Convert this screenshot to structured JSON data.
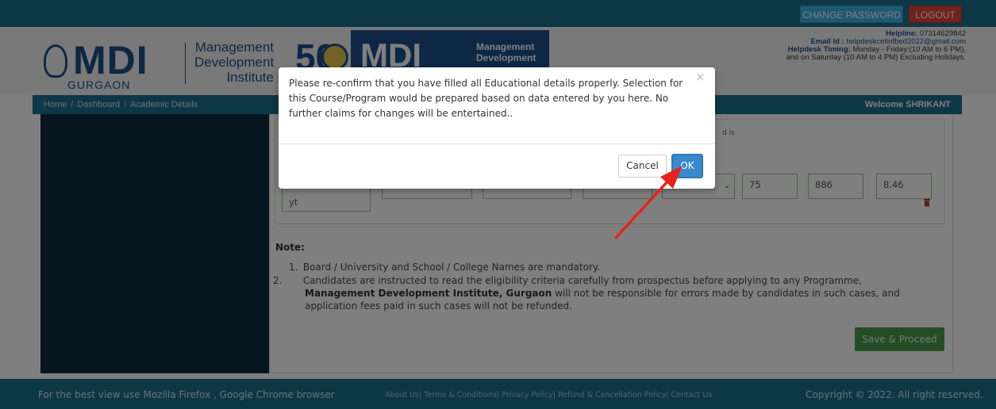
{
  "topbar": {
    "change_password": "CHANGE PASSWORD",
    "logout": "LOGOUT"
  },
  "header": {
    "logo_text": "MDI",
    "logo_city": "GURGAON",
    "logo_name_1": "Management",
    "logo_name_2": "Development",
    "logo_name_3": "Institute",
    "anniv_number": "50",
    "logo2_text": "MDI",
    "logo2_name_1": "Management",
    "logo2_name_2": "Development",
    "helpline_label": "Helpline: ",
    "helpline_value": "07314629842",
    "email_label": "Email Id : ",
    "email_value": "helpdeskcetinfbed2022@gmail.com",
    "timing_label": "Helpdesk Timing: ",
    "timing_value": "Monday - Friday:(10 AM to 6 PM),",
    "timing_value_2": "and on Saturday (10 AM to 4 PM) Excluding Holidays."
  },
  "breadcrumb": {
    "items": [
      "Home",
      "Dashboard",
      "Academic Details"
    ],
    "welcome": "Welcome SHRIKANT"
  },
  "form": {
    "panel_note": "d is",
    "fields": {
      "first": "yt",
      "percent": "75",
      "marks": "886",
      "cgpa": "8.46"
    }
  },
  "notes": {
    "heading": "Note:",
    "item1": "Board / University and School / College Names are mandatory.",
    "item2_pre": "Candidates are instructed to read the eligibility criteria carefully from prospectus before applying to any Programme, ",
    "item2_bold": "Management Development Institute, Gurgaon",
    "item2_post": " will not be responsible for errors made by candidates in such cases, and application fees paid in such cases will not be refunded."
  },
  "save_button": "Save & Proceed",
  "footer": {
    "left": "For the best view use Mozilla Firefox , Google Chrome browser",
    "links": "About Us| Terms & Conditions| Privacy Policy| Refund & Cancellation Policy| Contact Us",
    "right": "Copyright © 2022. All right reserved."
  },
  "modal": {
    "message": "Please re-confirm that you have filled all Educational details properly. Selection for this Course/Program would be prepared based on data entered by you here. No further claims for changes will be entertained..",
    "close": "×",
    "cancel": "Cancel",
    "ok": "OK"
  },
  "colors": {
    "primary_bar": "#1d6f8c",
    "brand_blue": "#1d4e8b",
    "logout_red": "#e0443a",
    "change_pw_blue": "#3db2e6",
    "save_green": "#4b9b4a",
    "ok_blue": "#3989cf",
    "annotation_arrow": "#e8231b"
  }
}
